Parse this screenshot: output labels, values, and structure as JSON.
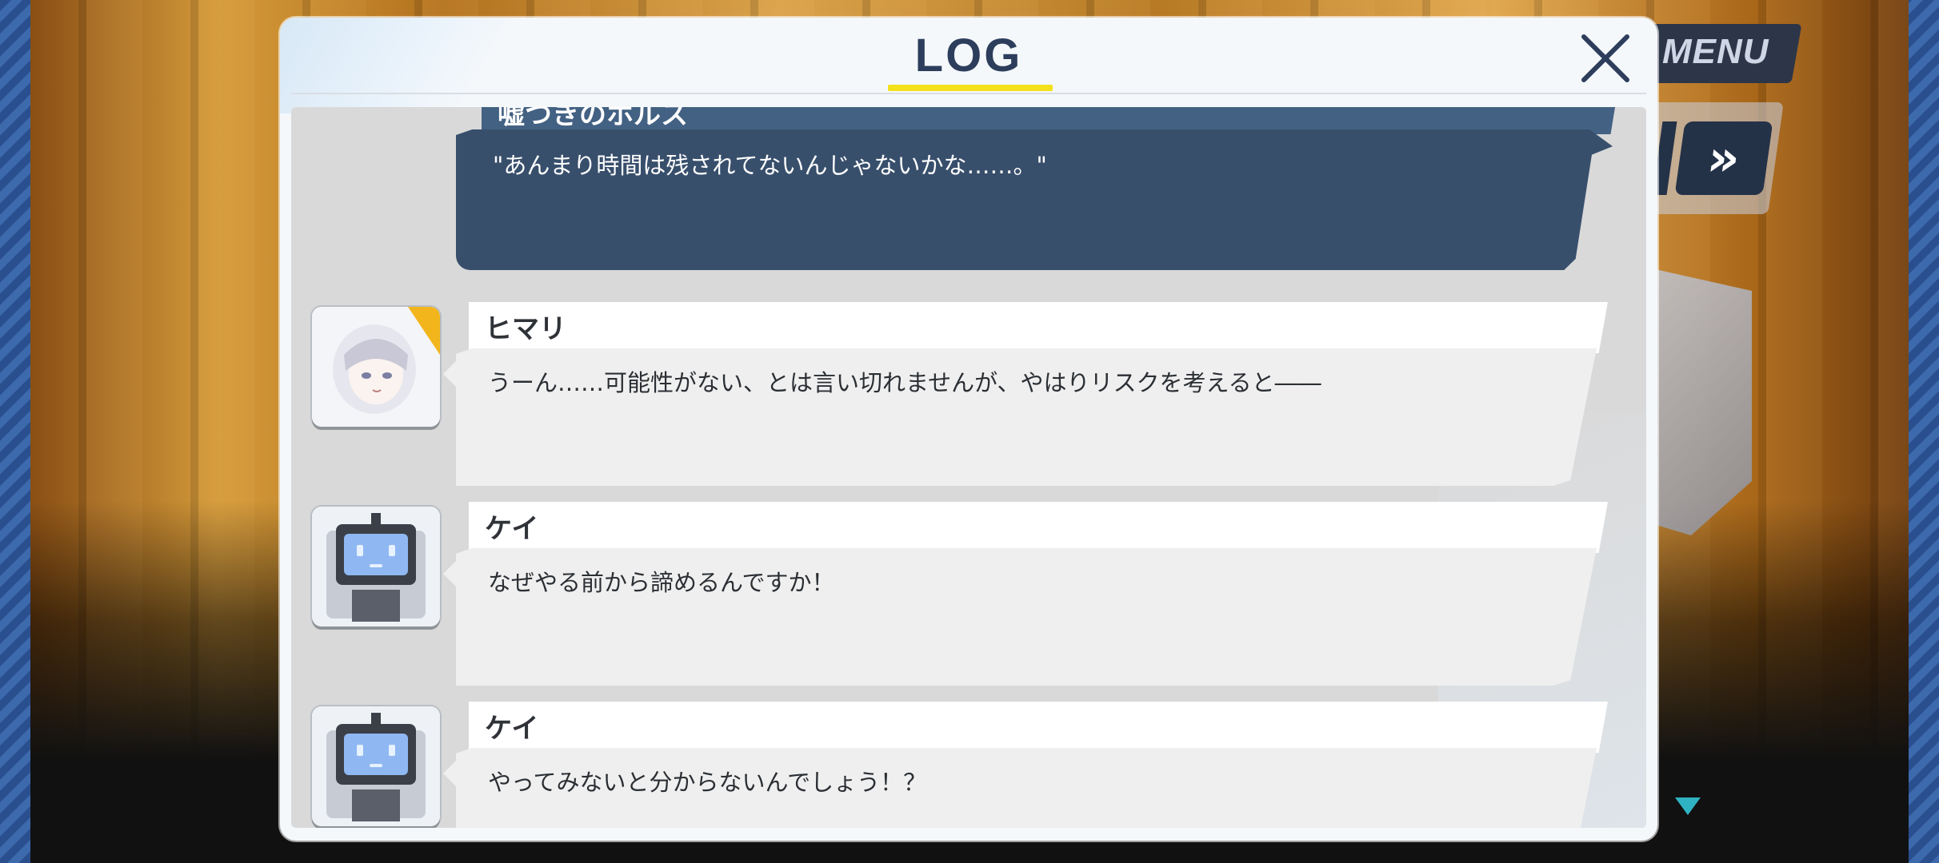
{
  "menu": {
    "label": "MENU"
  },
  "controls": {
    "fast_forward_glyph": "»",
    "fast_forward_icon": "fast-forward-icon",
    "scroll_marker_icon": "triangle-down-icon"
  },
  "log": {
    "title": "LOG",
    "close_icon": "close-icon",
    "accent_color": "#f2e11b",
    "entries": [
      {
        "speaker": "嘘つきのホルス",
        "text": "\"あんまり時間は残されてないんじゃないかな……。\"",
        "style": "narration-dark",
        "avatar": "none"
      },
      {
        "speaker": "ヒマリ",
        "text": "うーん……可能性がない、とは言い切れませんが、やはりリスクを考えると――",
        "avatar": "himari-portrait"
      },
      {
        "speaker": "ケイ",
        "text": "なぜやる前から諦めるんですか！",
        "avatar": "robot-portrait"
      },
      {
        "speaker": "ケイ",
        "text": "やってみないと分からないんでしょう！？",
        "avatar": "robot-portrait"
      }
    ]
  }
}
